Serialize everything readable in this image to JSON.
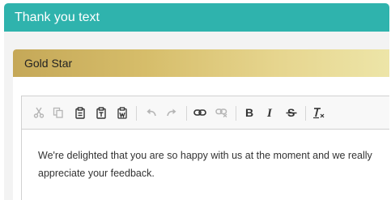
{
  "panel": {
    "title": "Thank you text"
  },
  "card": {
    "title": "Gold Star"
  },
  "toolbar": {
    "buttons": [
      {
        "icon": "cut-icon"
      },
      {
        "icon": "copy-icon"
      },
      {
        "icon": "paste-icon"
      },
      {
        "icon": "paste-text-icon"
      },
      {
        "icon": "paste-from-word-icon"
      },
      {
        "icon": "undo-icon"
      },
      {
        "icon": "redo-icon"
      },
      {
        "icon": "link-icon"
      },
      {
        "icon": "unlink-icon"
      },
      {
        "icon": "bold-icon"
      },
      {
        "icon": "italic-icon"
      },
      {
        "icon": "strikethrough-icon"
      },
      {
        "icon": "remove-format-icon"
      }
    ]
  },
  "editor": {
    "text": "We're delighted that you are so happy with us at the moment and we really appreciate your feedback."
  },
  "colors": {
    "header": "#2fb3ad",
    "gold_start": "#c5a858",
    "gold_end": "#ede5a8",
    "disabled_icon": "#b5b5b5",
    "active_icon": "#333333"
  }
}
